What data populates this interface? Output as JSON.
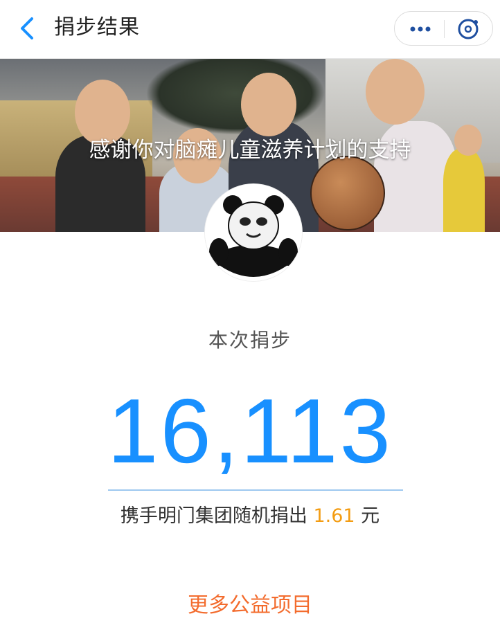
{
  "header": {
    "title": "捐步结果",
    "back_icon": "chevron-left-icon",
    "more_icon": "more-dots-icon",
    "close_icon": "close-circle-icon"
  },
  "banner": {
    "caption": "感谢你对脑瘫儿童滋养计划的支持"
  },
  "avatar": {
    "icon": "panda-meme-avatar"
  },
  "result": {
    "label": "本次捐步",
    "steps": "16,113",
    "donation_prefix": "携手明门集团随机捐出",
    "donation_amount": "1.61",
    "donation_unit": "元"
  },
  "links": {
    "more_projects": "更多公益项目"
  },
  "colors": {
    "accent_blue": "#1890ff",
    "amount_orange": "#f39c12",
    "link_orange": "#f36c2e"
  }
}
